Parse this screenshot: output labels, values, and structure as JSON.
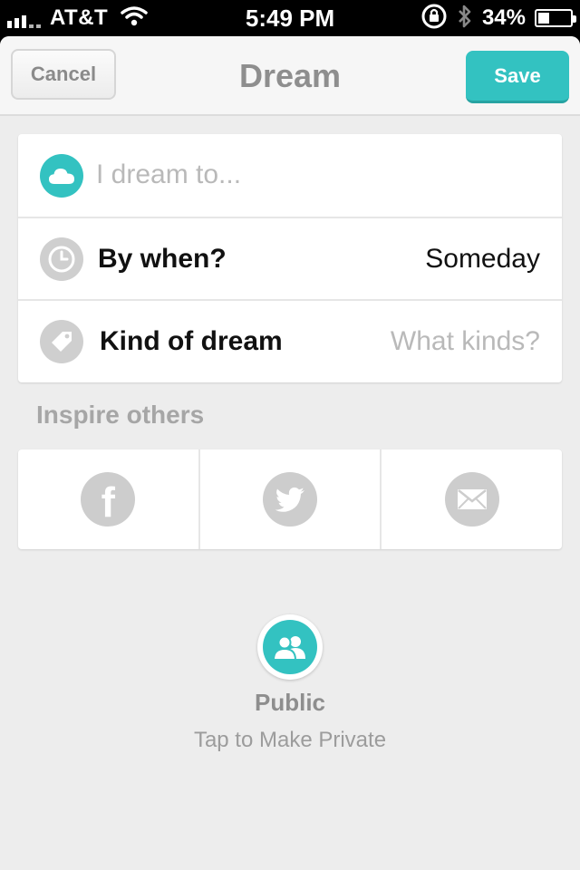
{
  "status_bar": {
    "carrier": "AT&T",
    "time": "5:49 PM",
    "battery": "34%",
    "battery_level": 0.34,
    "icons": [
      "signal-icon",
      "wifi-icon",
      "rotation-lock-icon",
      "bluetooth-icon",
      "battery-icon"
    ]
  },
  "navbar": {
    "cancel_label": "Cancel",
    "title": "Dream",
    "save_label": "Save",
    "accent_color": "#33c2c1"
  },
  "form": {
    "dream_placeholder": "I dream to...",
    "dream_value": "",
    "by_when_label": "By when?",
    "by_when_value": "Someday",
    "kind_label": "Kind of dream",
    "kind_placeholder": "What kinds?"
  },
  "inspire": {
    "title": "Inspire others",
    "share_options": [
      "facebook",
      "twitter",
      "email"
    ]
  },
  "privacy": {
    "state": "Public",
    "hint": "Tap to Make Private"
  }
}
